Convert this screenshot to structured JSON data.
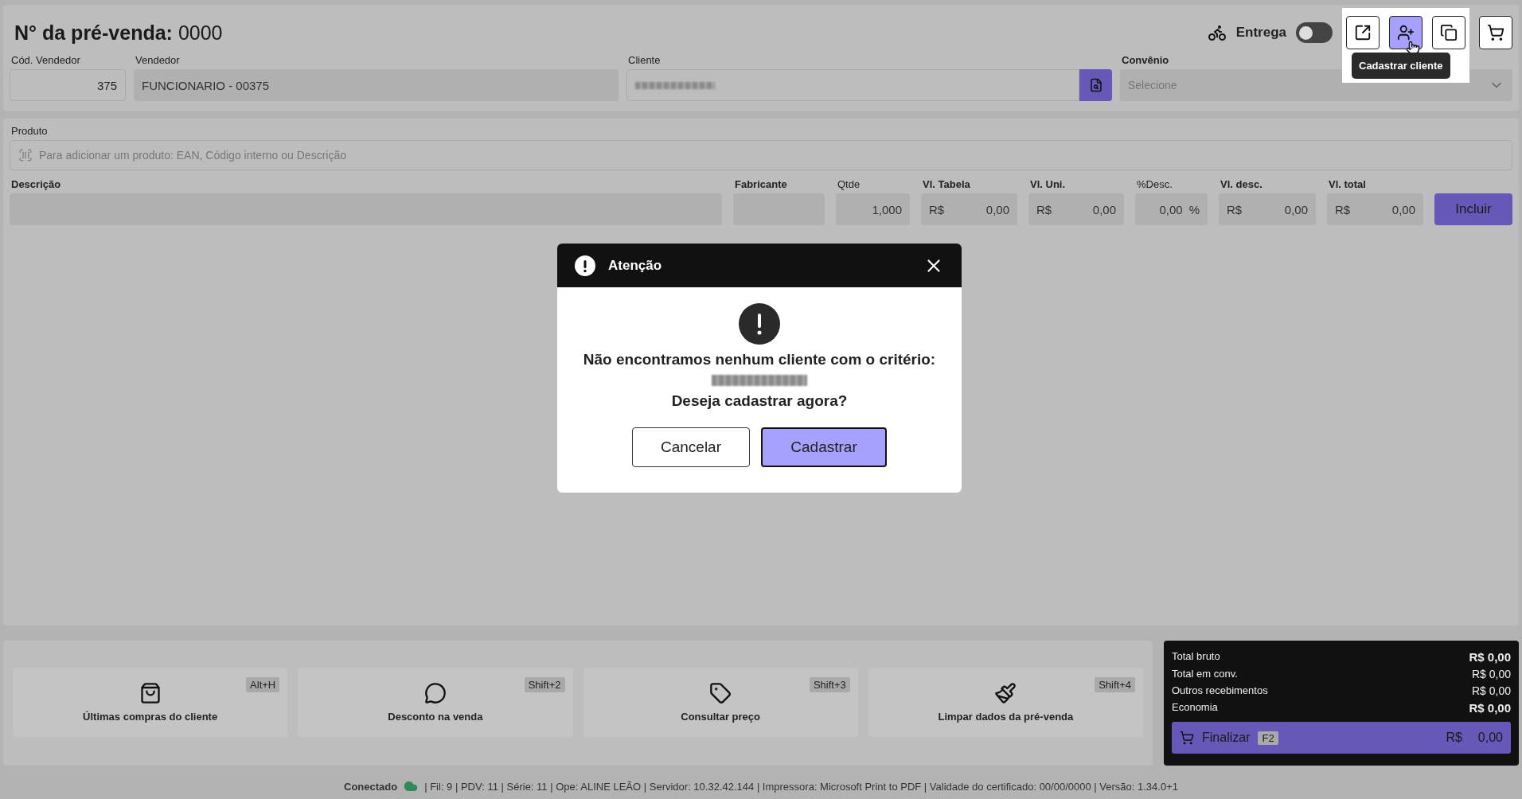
{
  "header": {
    "title_label": "N° da pré-venda:",
    "title_number": "0000",
    "delivery": {
      "label": "Entrega",
      "on": false
    },
    "toolbar": [
      {
        "selected": false,
        "highlighted": true
      },
      {
        "selected": true,
        "highlighted": true
      },
      {
        "selected": false,
        "highlighted": true
      },
      {
        "selected": false,
        "highlighted": false
      }
    ],
    "tooltip": "Cadastrar cliente"
  },
  "seller_fields": [
    {
      "label": "Cód. Vendedor",
      "value": "375",
      "kind": "number"
    },
    {
      "label": "Vendedor",
      "value": "FUNCIONARIO - 00375",
      "kind": "disabled"
    },
    {
      "label": "Cliente",
      "kind": "search"
    },
    {
      "label": "Convênio",
      "placeholder": "Selecione",
      "kind": "select"
    }
  ],
  "product": {
    "label": "Produto",
    "placeholder": "Para adicionar um produto: EAN, Código interno ou Descrição"
  },
  "item_fields": [
    {
      "label": "Descrição",
      "bold": true
    },
    {
      "label": "Fabricante",
      "bold": true
    },
    {
      "label": "Qtde",
      "bold": false,
      "value": "1,000"
    },
    {
      "label": "Vl. Tabela",
      "bold": true,
      "prefix": "R$",
      "value": "0,00"
    },
    {
      "label": "Vl. Uni.",
      "bold": true,
      "prefix": "R$",
      "value": "0,00"
    },
    {
      "label": "%Desc.",
      "bold": false,
      "value": "0,00",
      "suffix": "%"
    },
    {
      "label": "Vl. desc.",
      "bold": true,
      "prefix": "R$",
      "value": "0,00"
    },
    {
      "label": "Vl. total",
      "bold": true,
      "prefix": "R$",
      "value": "0,00"
    }
  ],
  "include_button": "Incluir",
  "dialog": {
    "title": "Atenção",
    "message": "Não encontramos nenhum cliente com o critério:",
    "question": "Deseja cadastrar agora?",
    "buttons": [
      {
        "label": "Cancelar",
        "primary": false
      },
      {
        "label": "Cadastrar",
        "primary": true
      }
    ]
  },
  "actions": [
    {
      "label": "Últimas compras do cliente",
      "shortcut": "Alt+H"
    },
    {
      "label": "Desconto na venda",
      "shortcut": "Shift+2"
    },
    {
      "label": "Consultar preço",
      "shortcut": "Shift+3"
    },
    {
      "label": "Limpar dados da pré-venda",
      "shortcut": "Shift+4"
    }
  ],
  "totals": [
    {
      "label": "Total bruto",
      "value": "R$ 0,00",
      "bold": true
    },
    {
      "label": "Total em conv.",
      "value": "R$ 0,00",
      "bold": false
    },
    {
      "label": "Outros recebimentos",
      "value": "R$ 0,00",
      "bold": false
    },
    {
      "label": "Economia",
      "value": "R$ 0,00",
      "bold": true
    }
  ],
  "finalize": {
    "label": "Finalizar",
    "key": "F2",
    "currency": "R$",
    "value": "0,00"
  },
  "status_bar": {
    "state": "Conectado",
    "details": "| Fil: 9 | PDV: 11 | Série: 11 | Ope: ALINE LEÃO | Servidor: 10.32.42.144 | Impressora: Microsoft Print to PDF | Validade do certificado: 00/00/0000 | Versão: 1.34.0+1"
  }
}
